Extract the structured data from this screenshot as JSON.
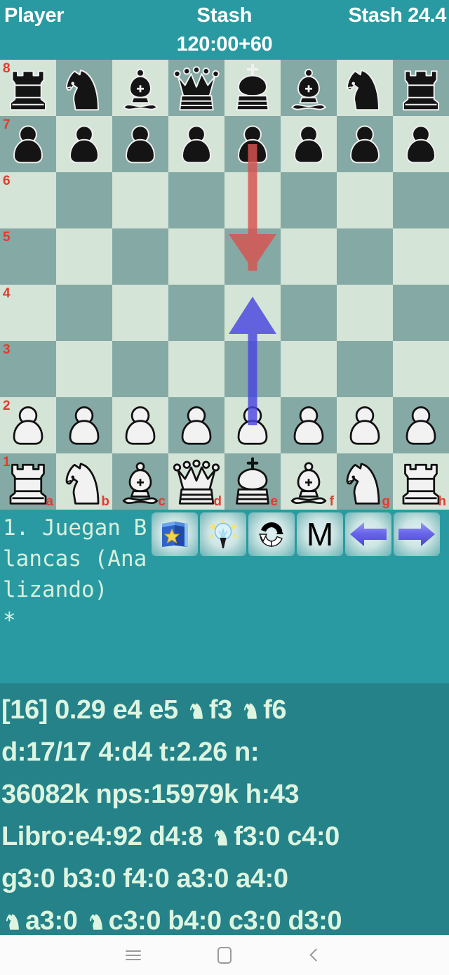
{
  "header": {
    "player_label": "Player",
    "engine_label": "Stash",
    "engine_version": "Stash 24.4",
    "clock": "120:00+60"
  },
  "board": {
    "orientation": "white-bottom",
    "files": [
      "a",
      "b",
      "c",
      "d",
      "e",
      "f",
      "g",
      "h"
    ],
    "ranks": [
      "8",
      "7",
      "6",
      "5",
      "4",
      "3",
      "2",
      "1"
    ],
    "light_square_color": "#d4e4d6",
    "dark_square_color": "#85a9a4",
    "coord_color": "#e23b2e",
    "position_rows": [
      [
        "br",
        "bn",
        "bb",
        "bq",
        "bk",
        "bb",
        "bn",
        "br"
      ],
      [
        "bp",
        "bp",
        "bp",
        "bp",
        "bp",
        "bp",
        "bp",
        "bp"
      ],
      [
        "",
        "",
        "",
        "",
        "",
        "",
        "",
        ""
      ],
      [
        "",
        "",
        "",
        "",
        "",
        "",
        "",
        ""
      ],
      [
        "",
        "",
        "",
        "",
        "",
        "",
        "",
        ""
      ],
      [
        "",
        "",
        "",
        "",
        "",
        "",
        "",
        ""
      ],
      [
        "wp",
        "wp",
        "wp",
        "wp",
        "wp",
        "wp",
        "wp",
        "wp"
      ],
      [
        "wr",
        "wn",
        "wb",
        "wq",
        "wk",
        "wb",
        "wn",
        "wr"
      ]
    ],
    "arrows": [
      {
        "name": "black-move-arrow",
        "from": "e7",
        "to": "e5",
        "color": "#d9534f"
      },
      {
        "name": "white-move-arrow",
        "from": "e2",
        "to": "e4",
        "color": "#4a46e0"
      }
    ]
  },
  "status": {
    "text": "1. Juegan Blancas (Analizando)\n*"
  },
  "toolbar": {
    "buttons": [
      {
        "name": "opening-book-button",
        "icon": "book-star-icon",
        "label": ""
      },
      {
        "name": "hint-button",
        "icon": "lightbulb-icon",
        "label": ""
      },
      {
        "name": "flip-board-button",
        "icon": "refresh-icon",
        "label": ""
      },
      {
        "name": "mode-button",
        "icon": "letter-m-icon",
        "label": "M"
      },
      {
        "name": "previous-move-button",
        "icon": "arrow-left-icon",
        "label": ""
      },
      {
        "name": "next-move-button",
        "icon": "arrow-right-icon",
        "label": ""
      }
    ]
  },
  "engine_output": {
    "lines": [
      "[16] 0.29 e4 e5 ♞f3 ♞f6",
      "d:17/17 4:d4 t:2.26 n:",
      "36082k nps:15979k h:43",
      "Libro:e4:92 d4:8 ♞f3:0 c4:0",
      "g3:0 b3:0 f4:0 a3:0 a4:0",
      "♞a3:0 ♞c3:0 b4:0 c3:0 d3:0"
    ],
    "depth_info": "[16]",
    "evaluation": "0.29",
    "principal_variation": "e4 e5 Nf3 Nf6",
    "depth": "d:17/17",
    "current_move": "4:d4",
    "time": "t:2.26",
    "nodes": "n:36082k",
    "nps": "nps:15979k",
    "hash": "h:43",
    "book_label": "Libro",
    "book_entries": [
      {
        "move": "e4",
        "weight": "92"
      },
      {
        "move": "d4",
        "weight": "8"
      },
      {
        "move": "Nf3",
        "weight": "0"
      },
      {
        "move": "c4",
        "weight": "0"
      },
      {
        "move": "g3",
        "weight": "0"
      },
      {
        "move": "b3",
        "weight": "0"
      },
      {
        "move": "f4",
        "weight": "0"
      },
      {
        "move": "a3",
        "weight": "0"
      },
      {
        "move": "a4",
        "weight": "0"
      },
      {
        "move": "Na3",
        "weight": "0"
      },
      {
        "move": "Nc3",
        "weight": "0"
      },
      {
        "move": "b4",
        "weight": "0"
      },
      {
        "move": "c3",
        "weight": "0"
      },
      {
        "move": "d3",
        "weight": "0"
      }
    ]
  },
  "navbar": {
    "recents_label": "recents",
    "home_label": "home",
    "back_label": "back"
  },
  "colors": {
    "background_teal": "#2a9aa2",
    "engine_panel_teal": "#258289",
    "text_light": "#ddf5e0",
    "header_text": "#ffffff"
  }
}
